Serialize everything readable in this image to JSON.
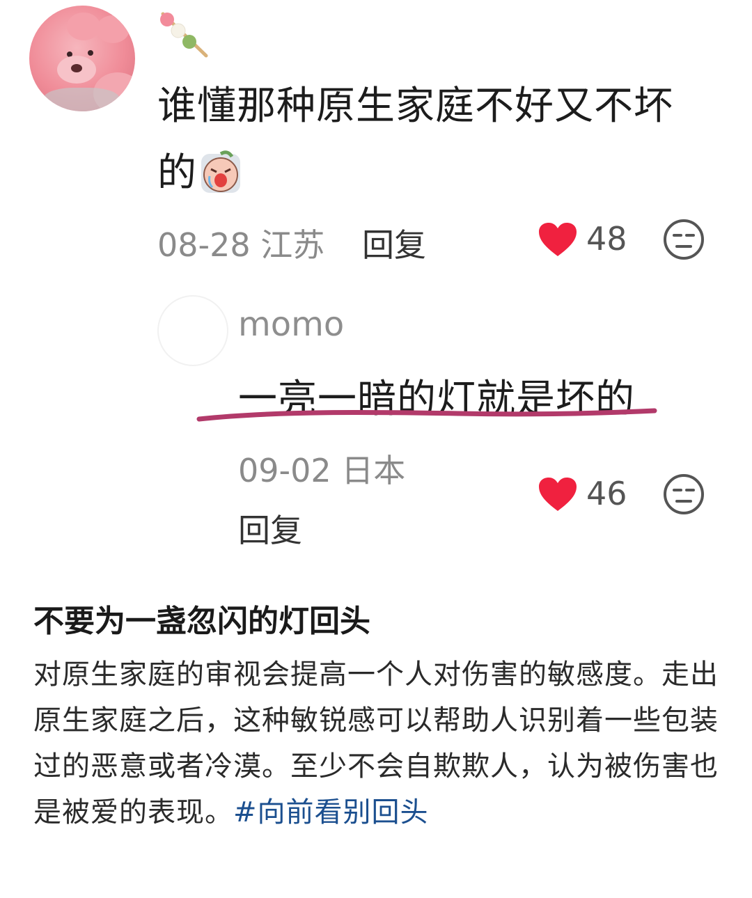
{
  "comment": {
    "text_line1": "谁懂那种原生家庭不好又不坏",
    "text_line2": "的",
    "date": "08-28",
    "location": "江苏",
    "reply_label": "回复",
    "likes": "48"
  },
  "reply": {
    "username": "momo",
    "text": "一亮一暗的灯就是坏的",
    "date": "09-02",
    "location": "日本",
    "reply_label": "回复",
    "likes": "46"
  },
  "post": {
    "title": "不要为一盏忽闪的灯回头",
    "body": "对原生家庭的审视会提高一个人对伤害的敏感度。走出原生家庭之后，这种敏锐感可以帮助人识别着一些包装过的恶意或者冷漠。至少不会自欺欺人，认为被伤害也是被爱的表现。",
    "hashtag": "#向前看别回头"
  },
  "colors": {
    "like_heart": "#f0213f",
    "hashtag": "#1b4f8f",
    "underline": "#b23a6a"
  },
  "icons": {
    "like": "heart-icon",
    "dislike": "meh-face-icon"
  }
}
